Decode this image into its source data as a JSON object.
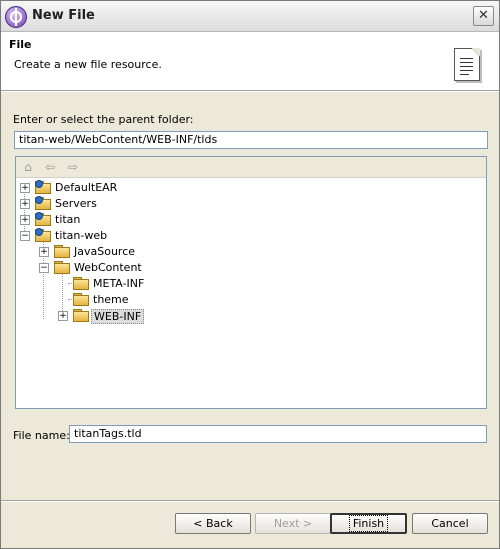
{
  "window": {
    "title": "New File"
  },
  "header": {
    "title": "File",
    "description": "Create a new file resource."
  },
  "parent_folder": {
    "label": "Enter or select the parent folder:",
    "value": "titan-web/WebContent/WEB-INF/tlds"
  },
  "tree": {
    "toolbar": {
      "home_icon": "home-icon",
      "back_icon": "back-arrow-icon",
      "forward_icon": "forward-arrow-icon"
    },
    "nodes": [
      {
        "label": "DefaultEAR",
        "expander": "+"
      },
      {
        "label": "Servers",
        "expander": "+"
      },
      {
        "label": "titan",
        "expander": "+"
      },
      {
        "label": "titan-web",
        "expander": "−"
      },
      {
        "label": "JavaSource",
        "expander": "+"
      },
      {
        "label": "WebContent",
        "expander": "−"
      },
      {
        "label": "META-INF",
        "expander": ""
      },
      {
        "label": "theme",
        "expander": ""
      },
      {
        "label": "WEB-INF",
        "expander": "+",
        "selected": true
      }
    ]
  },
  "file_name": {
    "label": "File name:",
    "value": "titanTags.tld"
  },
  "buttons": {
    "back": "< Back",
    "next": "Next >",
    "finish": "Finish",
    "cancel": "Cancel"
  },
  "colors": {
    "selection": "#dcdcdc",
    "field_border": "#7f9db9",
    "dialog_bg": "#ece9d8"
  }
}
